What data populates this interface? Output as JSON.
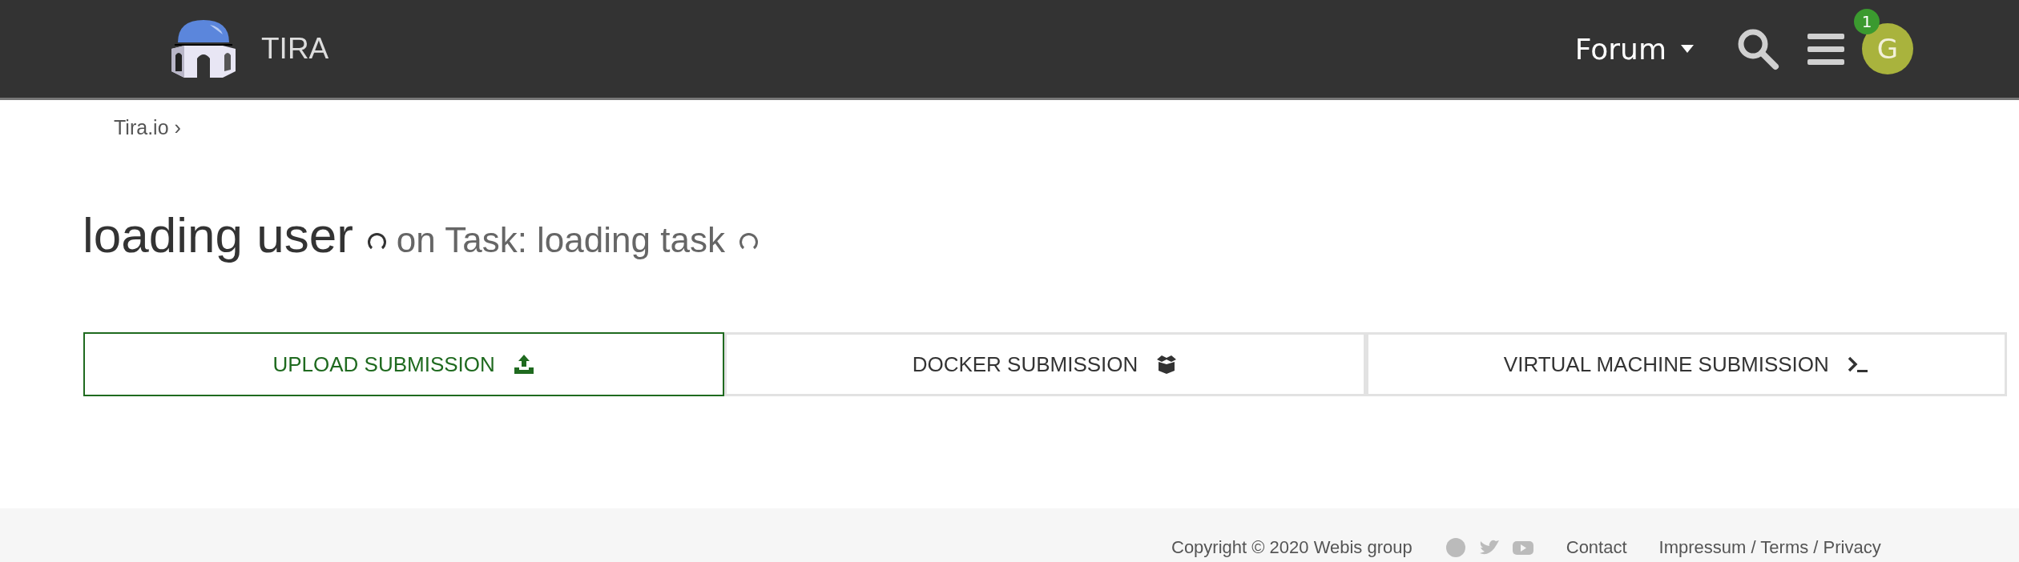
{
  "header": {
    "brand": "TIRA",
    "forum": "Forum",
    "notifications": "1",
    "avatar": "G"
  },
  "breadcrumb": [
    "Tira.io ›"
  ],
  "title": {
    "user": "loading user",
    "task": "on Task: loading task"
  },
  "tabs": [
    {
      "label": "UPLOAD SUBMISSION",
      "kind": "upload",
      "selected": true
    },
    {
      "label": "DOCKER SUBMISSION",
      "kind": "docker",
      "selected": false
    },
    {
      "label": "VIRTUAL MACHINE SUBMISSION",
      "kind": "vm",
      "selected": false
    }
  ],
  "footer": {
    "copyright": "Copyright © 2020 Webis group",
    "links": [
      "Contact",
      "Impressum / Terms / Privacy"
    ]
  }
}
